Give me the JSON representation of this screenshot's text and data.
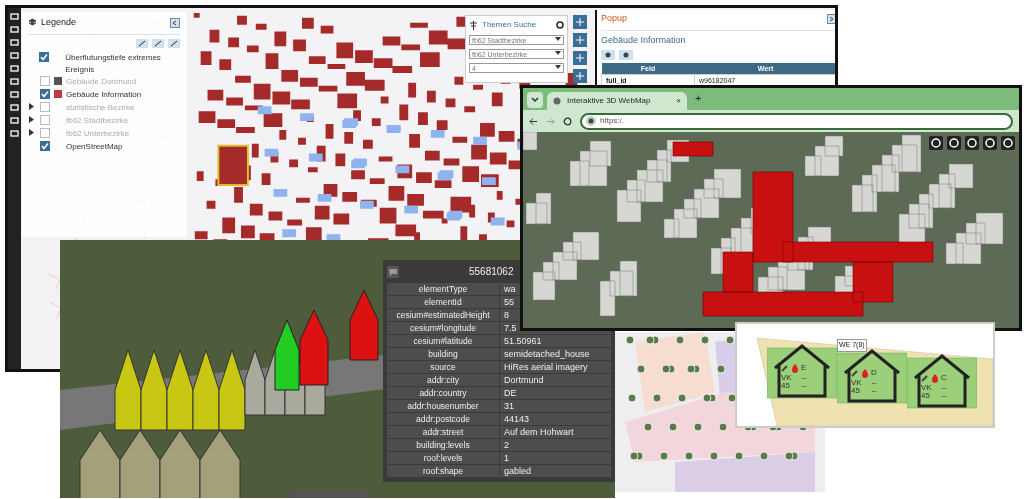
{
  "legend_window": {
    "title": "Legende",
    "layers": [
      {
        "label": "Überflutungstiefe extremes Ereignis",
        "checked": true,
        "disabled": false,
        "expandable": false
      },
      {
        "label": "Gebäude Dortmund",
        "checked": false,
        "disabled": true,
        "expandable": false,
        "color": "#555555"
      },
      {
        "label": "Gebäude Information",
        "checked": true,
        "disabled": false,
        "expandable": false,
        "color": "#c0393b"
      },
      {
        "label": "statistische Bezirke",
        "checked": false,
        "disabled": true,
        "expandable": true
      },
      {
        "label": "fb62 Stadtbezirke",
        "checked": false,
        "disabled": true,
        "expandable": true
      },
      {
        "label": "fb62 Unterbezirke",
        "checked": false,
        "disabled": true,
        "expandable": true
      },
      {
        "label": "OpenStreetMap",
        "checked": true,
        "disabled": false,
        "expandable": false
      }
    ]
  },
  "themen_suche": {
    "title": "Themen Suche",
    "selects": [
      "fb62 Stadtbezirke",
      "fb62 Unterbezirke",
      "4"
    ]
  },
  "popup": {
    "title": "Popup",
    "subtitle": "Gebäude Information",
    "table": {
      "columns": [
        "Feld",
        "Wert"
      ],
      "rows": [
        [
          "full_id",
          "w96182047"
        ]
      ]
    }
  },
  "browser": {
    "tab": {
      "title": "Interaktive 3D WebMap",
      "close": "×"
    },
    "new_tab": "+",
    "url": "https:/."
  },
  "feature_info": {
    "title": "55681062",
    "rows": [
      {
        "key": "elementType",
        "value": "wa"
      },
      {
        "key": "elementId",
        "value": "55"
      },
      {
        "key": "cesium#estimatedHeight",
        "value": "8"
      },
      {
        "key": "cesium#longitude",
        "value": "7.5"
      },
      {
        "key": "cesium#latitude",
        "value": "51.50961"
      },
      {
        "key": "building",
        "value": "semidetached_house"
      },
      {
        "key": "source",
        "value": "HiRes aerial imagery"
      },
      {
        "key": "addr:city",
        "value": "Dortmund"
      },
      {
        "key": "addr:country",
        "value": "DE"
      },
      {
        "key": "addr:housenumber",
        "value": "31"
      },
      {
        "key": "addr:postcode",
        "value": "44143"
      },
      {
        "key": "addr:street",
        "value": "Auf dem Hohwart"
      },
      {
        "key": "building:levels",
        "value": "2"
      },
      {
        "key": "roof:levels",
        "value": "1"
      },
      {
        "key": "roof:shape",
        "value": "gabled"
      }
    ]
  },
  "house_plan": {
    "tag": "WE 7(8)",
    "houses": [
      {
        "letter": "E",
        "code": "VK",
        "number": "45",
        "values": [
          "--",
          "--"
        ]
      },
      {
        "letter": "D",
        "code": "VK",
        "number": "45",
        "values": [
          "--",
          "--"
        ]
      },
      {
        "letter": "C",
        "code": "VK",
        "number": "45",
        "values": [
          "--",
          "--"
        ]
      }
    ]
  }
}
